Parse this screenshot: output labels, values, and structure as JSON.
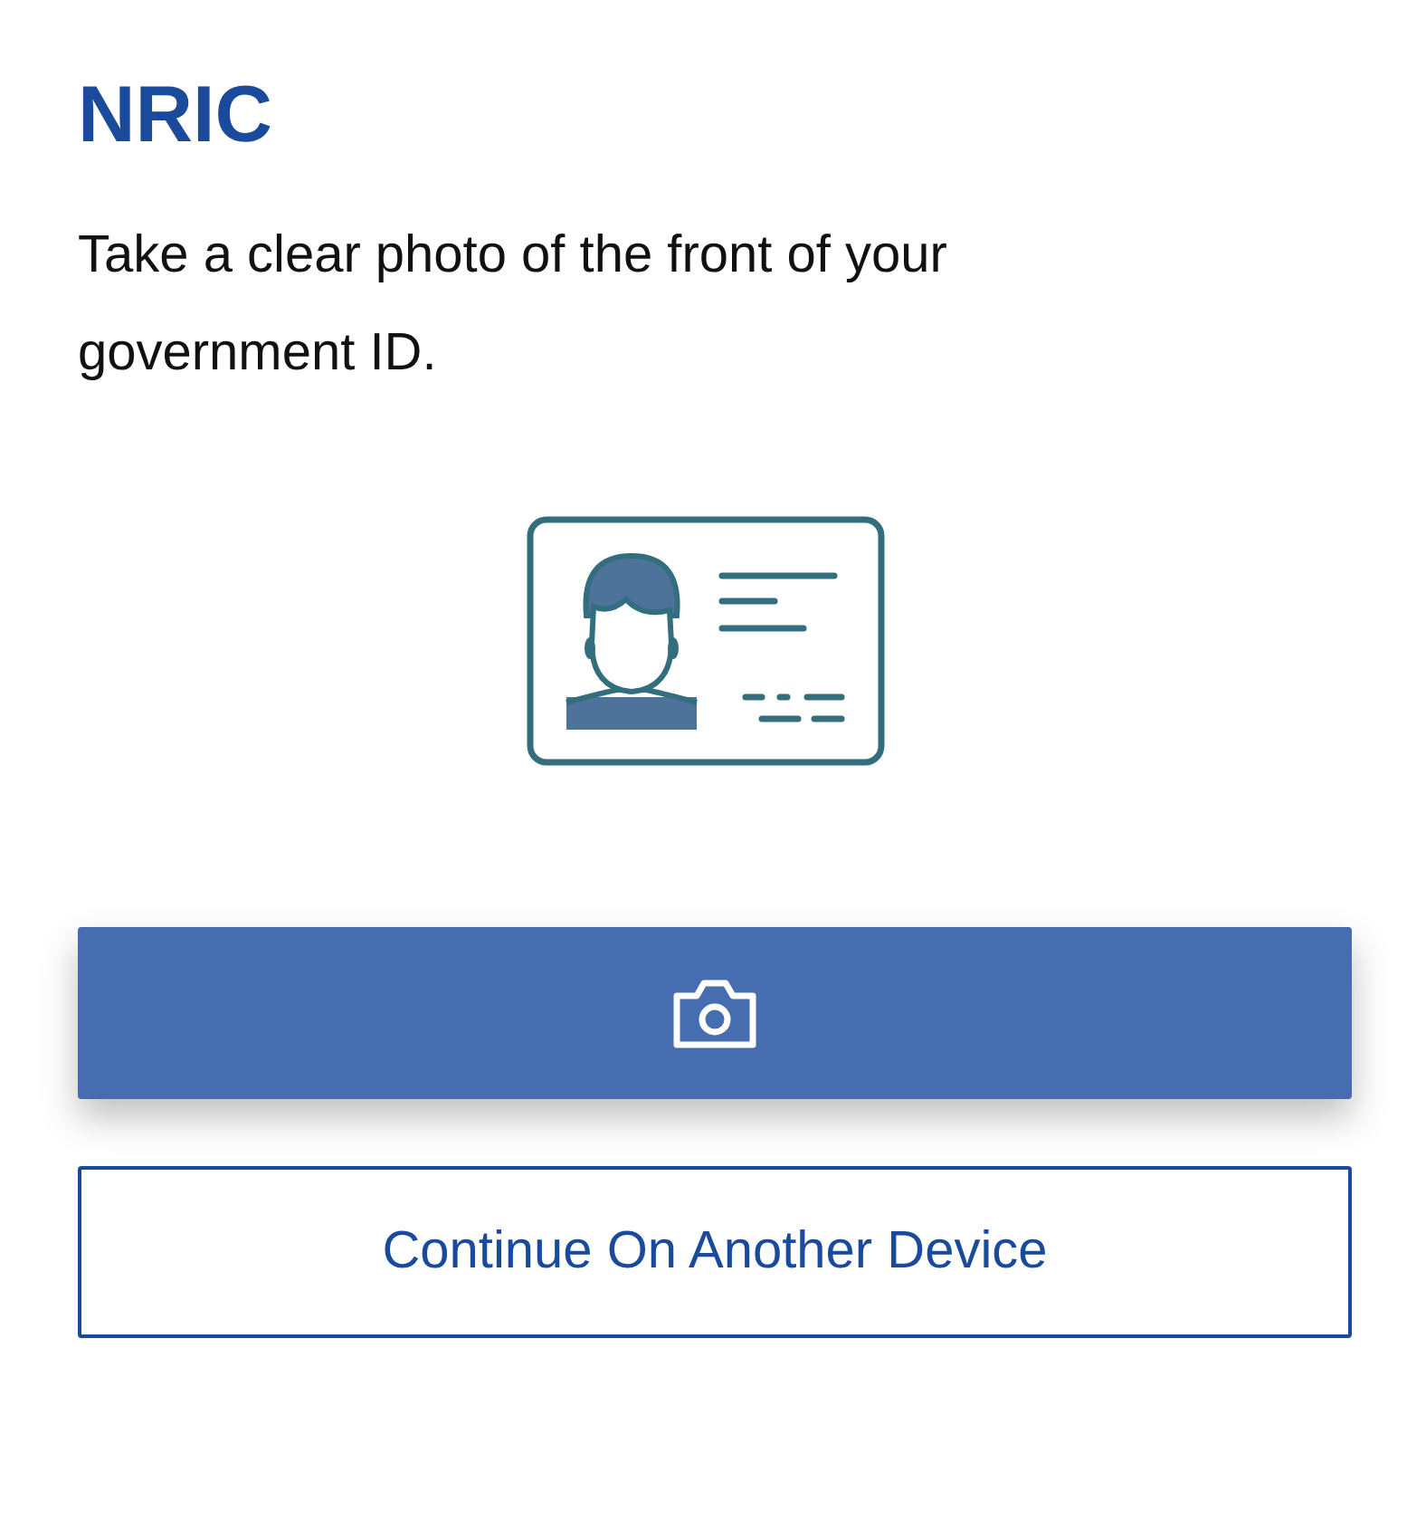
{
  "title": "NRIC",
  "instruction": "Take a clear photo of the front of your government ID.",
  "secondary_button": {
    "label": "Continue On Another Device"
  }
}
